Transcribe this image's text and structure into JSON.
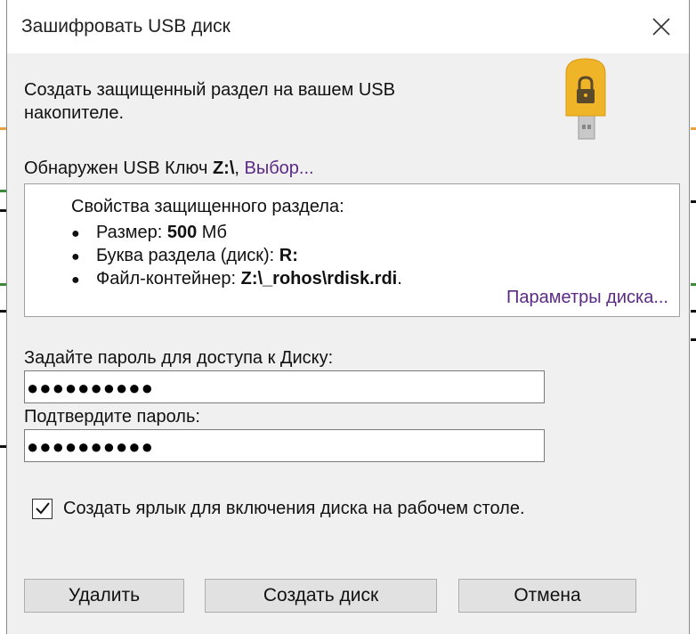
{
  "window": {
    "title": "Зашифровать USB диск",
    "close_icon": "close-icon"
  },
  "intro": {
    "text": "Создать защищенный раздел на вашем USB накопителе.",
    "icon": "usb-lock-icon"
  },
  "detected": {
    "prefix": "Обнаружен USB Ключ",
    "drive": "Z:\\",
    "separator": ",",
    "select_link": "Выбор..."
  },
  "properties": {
    "title": "Свойства защищенного раздела:",
    "items": [
      {
        "label": "Размер:",
        "value": "500",
        "suffix": "Мб"
      },
      {
        "label": "Буква раздела (диск):",
        "value": "R:",
        "suffix": ""
      },
      {
        "label": "Файл-контейнер:",
        "value": "Z:\\_rohos\\rdisk.rdi",
        "suffix": "."
      }
    ],
    "params_link": "Параметры диска..."
  },
  "password": {
    "label": "Задайте пароль для доступа к Диску:",
    "value": "●●●●●●●●●●"
  },
  "confirm": {
    "label": "Подтвердите пароль:",
    "value": "●●●●●●●●●●"
  },
  "shortcut": {
    "checked": true,
    "label": "Создать ярлык для включения диска на рабочем столе."
  },
  "buttons": {
    "delete": "Удалить",
    "create": "Создать диск",
    "cancel": "Отмена"
  },
  "colors": {
    "link": "#5b2a86",
    "usb_body": "#f0b429",
    "usb_plug": "#c8c8c8"
  }
}
